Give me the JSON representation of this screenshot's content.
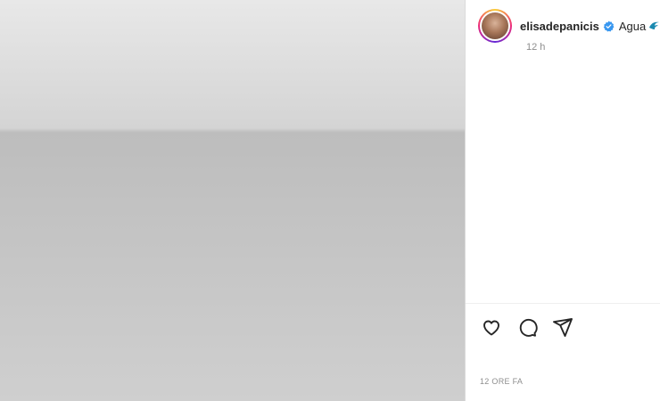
{
  "header": {
    "username": "elisadepanicis",
    "caption": "Agua",
    "caption_emoji": "water-wave-emoji",
    "time_small": "12 h"
  },
  "actions": {
    "icons": [
      "heart-icon",
      "comment-icon",
      "share-icon"
    ]
  },
  "footer": {
    "time": "12 ORE FA"
  },
  "colors": {
    "verified_blue": "#3897f0",
    "text": "#262626",
    "muted": "#8e8e8e"
  }
}
